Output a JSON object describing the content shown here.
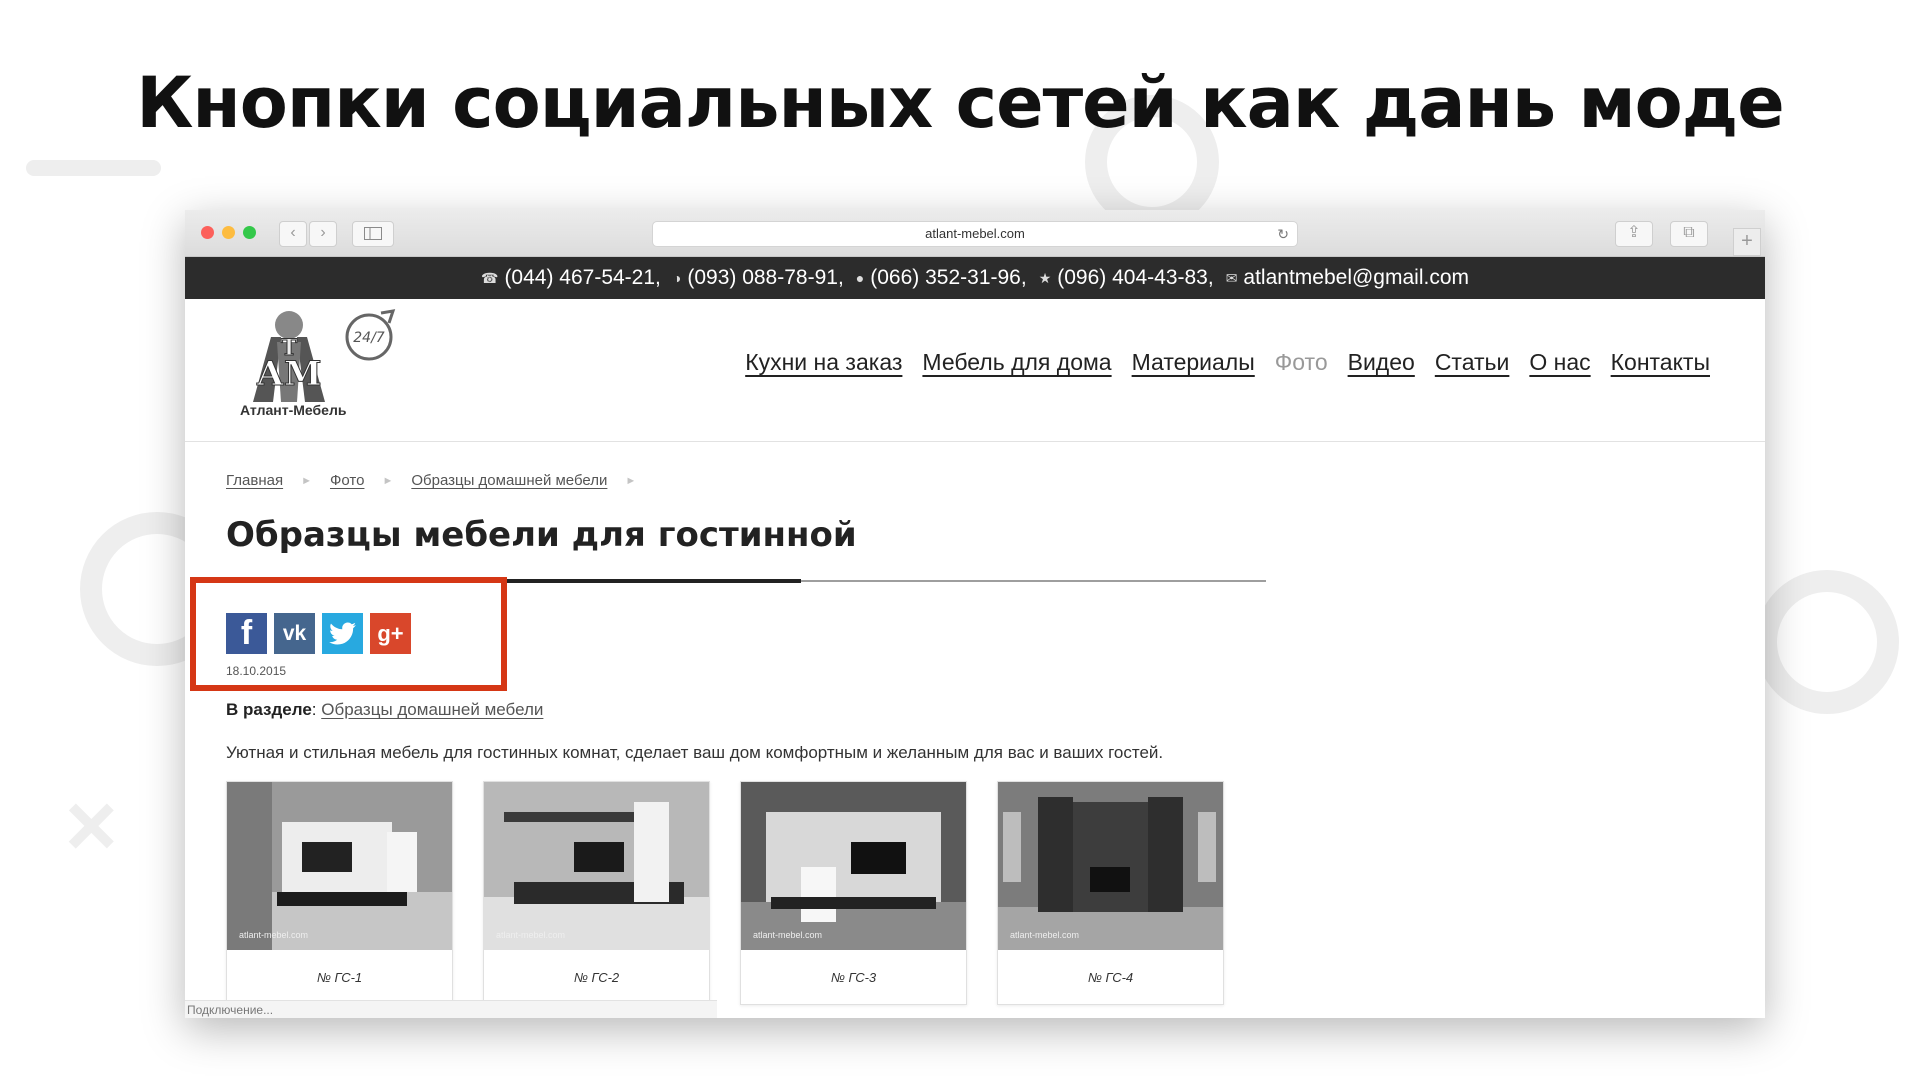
{
  "slide": {
    "title": "Кнопки социальных сетей как дань моде"
  },
  "browser": {
    "url": "atlant-mebel.com",
    "status": "Подключение..."
  },
  "contacts": [
    {
      "icon": "phone-icon",
      "text": "(044) 467-54-21,"
    },
    {
      "icon": "life-operator-icon",
      "text": "(093) 088-78-91,"
    },
    {
      "icon": "mts-operator-icon",
      "text": "(066) 352-31-96,"
    },
    {
      "icon": "kyivstar-operator-icon",
      "text": "(096) 404-43-83,"
    },
    {
      "icon": "mail-icon",
      "text": "atlantmebel@gmail.com"
    }
  ],
  "logo": {
    "caption": "Атлант-Мебель",
    "badge": "24/7"
  },
  "nav": [
    {
      "label": "Кухни на заказ",
      "active": false
    },
    {
      "label": "Мебель для дома",
      "active": false
    },
    {
      "label": "Материалы",
      "active": false
    },
    {
      "label": "Фото",
      "active": true
    },
    {
      "label": "Видео",
      "active": false
    },
    {
      "label": "Статьи",
      "active": false
    },
    {
      "label": "О нас",
      "active": false
    },
    {
      "label": "Контакты",
      "active": false
    }
  ],
  "breadcrumb": [
    "Главная",
    "Фото",
    "Образцы домашней мебели"
  ],
  "page": {
    "title": "Образцы мебели для гостинной",
    "date": "18.10.2015",
    "section_label": "В разделе",
    "section_link": "Образцы домашней мебели",
    "description": "Уютная и стильная мебель для гостинных комнат, сделает ваш дом комфортным и желанным для вас и ваших гостей."
  },
  "social": [
    {
      "name": "facebook",
      "glyph": "f",
      "color": "#3b5998"
    },
    {
      "name": "vk",
      "glyph": "vk",
      "color": "#45668e"
    },
    {
      "name": "twitter",
      "glyph": "",
      "color": "#28a9e0"
    },
    {
      "name": "google-plus",
      "glyph": "g+",
      "color": "#d9472b"
    }
  ],
  "gallery": [
    {
      "label": "№ ГС-1",
      "watermark": "atlant-mebel.com"
    },
    {
      "label": "№ ГС-2",
      "watermark": "atlant-mebel.com"
    },
    {
      "label": "№ ГС-3",
      "watermark": "atlant-mebel.com"
    },
    {
      "label": "№ ГС-4",
      "watermark": "atlant-mebel.com"
    }
  ],
  "colors": {
    "highlight": "#d53715",
    "contact_bar": "#2c2c2c"
  }
}
